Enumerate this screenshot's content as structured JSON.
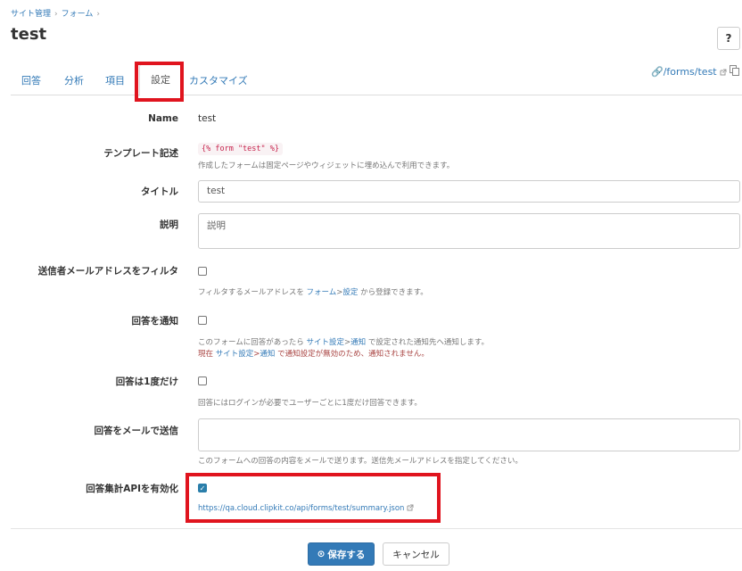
{
  "breadcrumb": {
    "items": [
      "サイト管理",
      "フォーム"
    ]
  },
  "page": {
    "title": "test",
    "help_label": "?"
  },
  "tabs": [
    "回答",
    "分析",
    "項目",
    "設定",
    "カスタマイズ"
  ],
  "forms_link": "/forms/test",
  "fields": {
    "name": {
      "label": "Name",
      "value": "test"
    },
    "template": {
      "label": "テンプレート記述",
      "code": "{% form \"test\" %}",
      "help": "作成したフォームは固定ページやウィジェットに埋め込んで利用できます。"
    },
    "title": {
      "label": "タイトル",
      "value": "test"
    },
    "description": {
      "label": "説明",
      "placeholder": "説明"
    },
    "filter": {
      "label": "送信者メールアドレスをフィルタ",
      "help_before": "フィルタするメールアドレスを",
      "link1": "フォーム",
      "link2": "設定",
      "help_after": "から登録できます。"
    },
    "notify": {
      "label": "回答を通知",
      "help_before": "このフォームに回答があったら",
      "link1": "サイト設定",
      "link2": "通知",
      "help_after": "で設定された通知先へ通知します。",
      "warn_before": "現在",
      "warn_after": "で通知設定が無効のため、通知されません。"
    },
    "once": {
      "label": "回答は1度だけ",
      "help": "回答にはログインが必要でユーザーごとに1度だけ回答できます。"
    },
    "email": {
      "label": "回答をメールで送信",
      "help": "このフォームへの回答の内容をメールで送ります。送信先メールアドレスを指定してください。"
    },
    "api": {
      "label": "回答集計APIを有効化",
      "url": "https://qa.cloud.clipkit.co/api/forms/test/summary.json",
      "checked": true
    }
  },
  "actions": {
    "save": "保存する",
    "cancel": "キャンセル"
  },
  "colors": {
    "link": "#337ab7",
    "primary": "#337ab7",
    "highlight": "#e0141e",
    "warning": "#a94442",
    "code": "#c7254e"
  }
}
